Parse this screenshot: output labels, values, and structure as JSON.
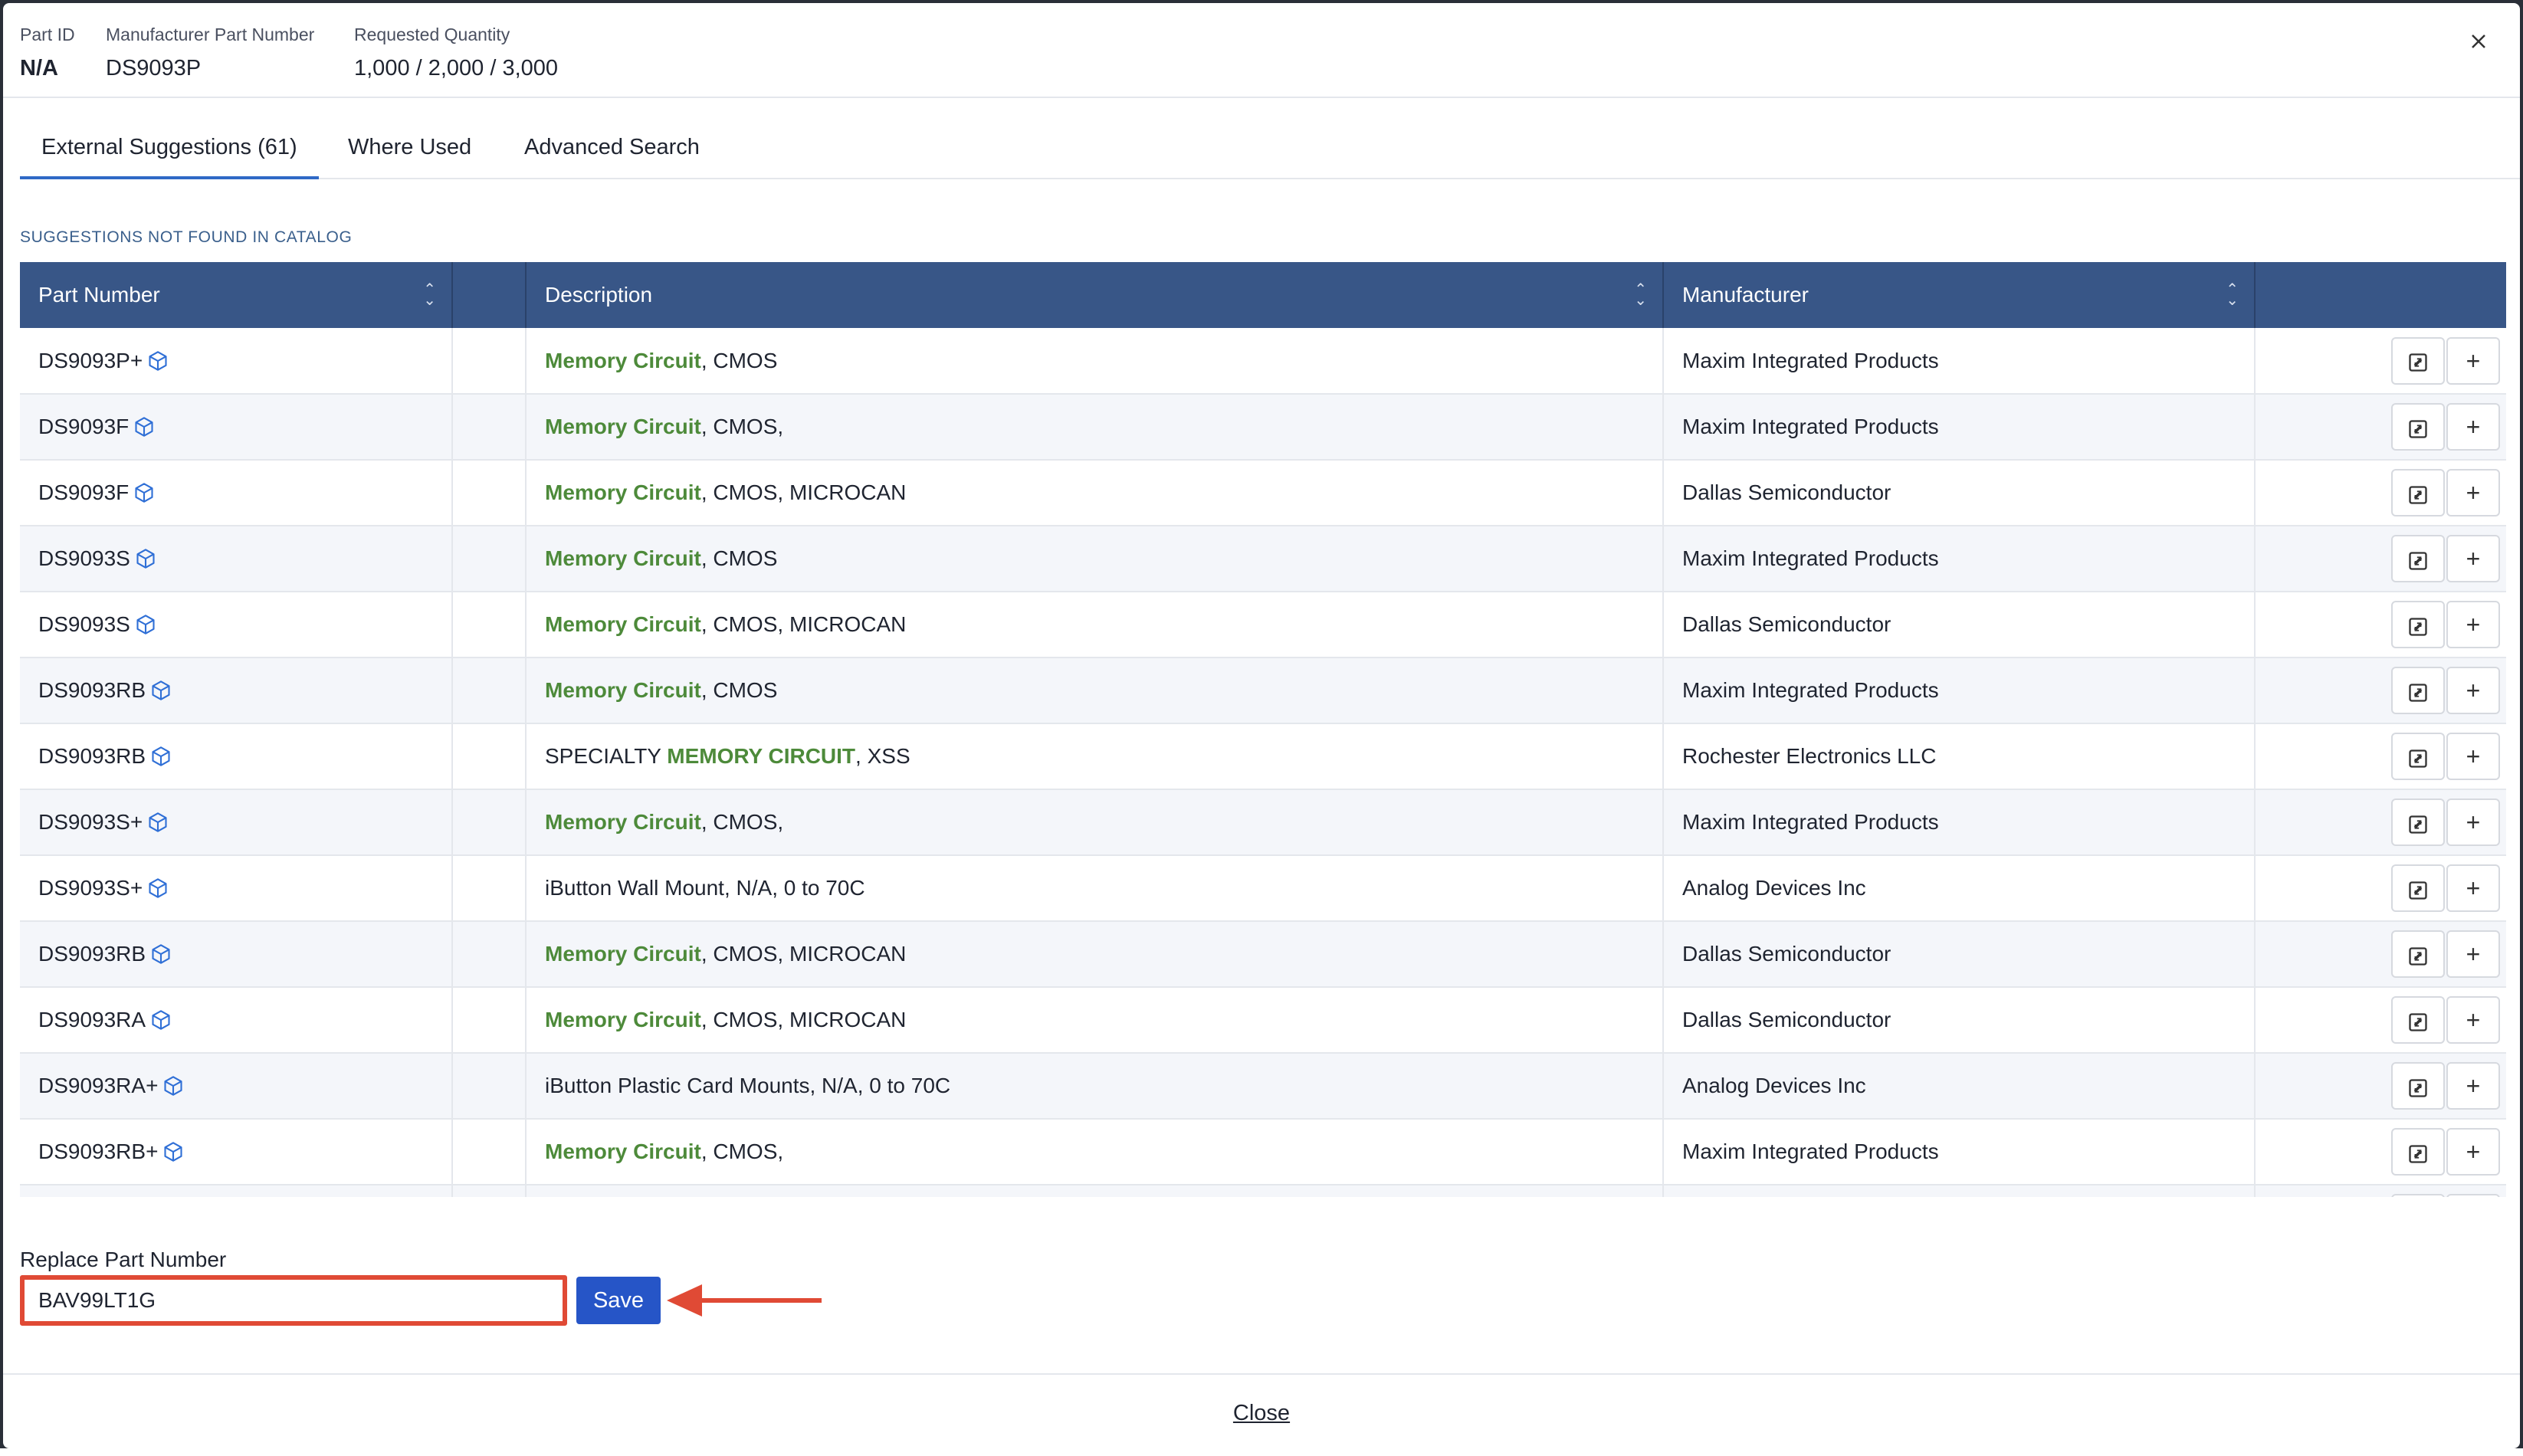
{
  "header": {
    "part_id_label": "Part ID",
    "part_id_value": "N/A",
    "mpn_label": "Manufacturer Part Number",
    "mpn_value": "DS9093P",
    "qty_label": "Requested Quantity",
    "qty_value": "1,000 / 2,000 / 3,000",
    "close_icon": "close-icon"
  },
  "tabs": [
    {
      "label": "External Suggestions (61)",
      "active": true
    },
    {
      "label": "Where Used",
      "active": false
    },
    {
      "label": "Advanced Search",
      "active": false
    }
  ],
  "section_title": "SUGGESTIONS NOT FOUND IN CATALOG",
  "table": {
    "columns": [
      "Part Number",
      "",
      "Description",
      "Manufacturer",
      ""
    ],
    "rows": [
      {
        "part": "DS9093P+",
        "desc_hl": "Memory Circuit",
        "desc_rest": ", CMOS",
        "desc_pre": "",
        "mfr": "Maxim Integrated Products"
      },
      {
        "part": "DS9093F",
        "desc_hl": "Memory Circuit",
        "desc_rest": ", CMOS,",
        "desc_pre": "",
        "mfr": "Maxim Integrated Products"
      },
      {
        "part": "DS9093F",
        "desc_hl": "Memory Circuit",
        "desc_rest": ", CMOS, MICROCAN",
        "desc_pre": "",
        "mfr": "Dallas Semiconductor"
      },
      {
        "part": "DS9093S",
        "desc_hl": "Memory Circuit",
        "desc_rest": ", CMOS",
        "desc_pre": "",
        "mfr": "Maxim Integrated Products"
      },
      {
        "part": "DS9093S",
        "desc_hl": "Memory Circuit",
        "desc_rest": ", CMOS, MICROCAN",
        "desc_pre": "",
        "mfr": "Dallas Semiconductor"
      },
      {
        "part": "DS9093RB",
        "desc_hl": "Memory Circuit",
        "desc_rest": ", CMOS",
        "desc_pre": "",
        "mfr": "Maxim Integrated Products"
      },
      {
        "part": "DS9093RB",
        "desc_hl": "MEMORY CIRCUIT",
        "desc_rest": ", XSS",
        "desc_pre": "SPECIALTY ",
        "mfr": "Rochester Electronics LLC"
      },
      {
        "part": "DS9093S+",
        "desc_hl": "Memory Circuit",
        "desc_rest": ", CMOS,",
        "desc_pre": "",
        "mfr": "Maxim Integrated Products"
      },
      {
        "part": "DS9093S+",
        "desc_hl": "",
        "desc_rest": "",
        "desc_pre": "iButton Wall Mount, N/A, 0 to 70C",
        "mfr": "Analog Devices Inc"
      },
      {
        "part": "DS9093RB",
        "desc_hl": "Memory Circuit",
        "desc_rest": ", CMOS, MICROCAN",
        "desc_pre": "",
        "mfr": "Dallas Semiconductor"
      },
      {
        "part": "DS9093RA",
        "desc_hl": "Memory Circuit",
        "desc_rest": ", CMOS, MICROCAN",
        "desc_pre": "",
        "mfr": "Dallas Semiconductor"
      },
      {
        "part": "DS9093RA+",
        "desc_hl": "",
        "desc_rest": "",
        "desc_pre": "iButton Plastic Card Mounts, N/A, 0 to 70C",
        "mfr": "Analog Devices Inc"
      },
      {
        "part": "DS9093RB+",
        "desc_hl": "Memory Circuit",
        "desc_rest": ", CMOS,",
        "desc_pre": "",
        "mfr": "Maxim Integrated Products"
      },
      {
        "part": "",
        "desc_hl": "",
        "desc_rest": "",
        "desc_pre": "",
        "mfr": ""
      }
    ],
    "row_icon": "cube-icon",
    "action_icons": [
      "replace-icon",
      "plus-icon"
    ]
  },
  "replace": {
    "label": "Replace Part Number",
    "value": "BAV99LT1G",
    "save_label": "Save"
  },
  "footer": {
    "close_label": "Close"
  },
  "colors": {
    "header_bg": "#385687",
    "highlight": "#4d8a3a",
    "save_bg": "#2655c7",
    "annotation_red": "#e04a35",
    "tab_active": "#2f69c6"
  }
}
